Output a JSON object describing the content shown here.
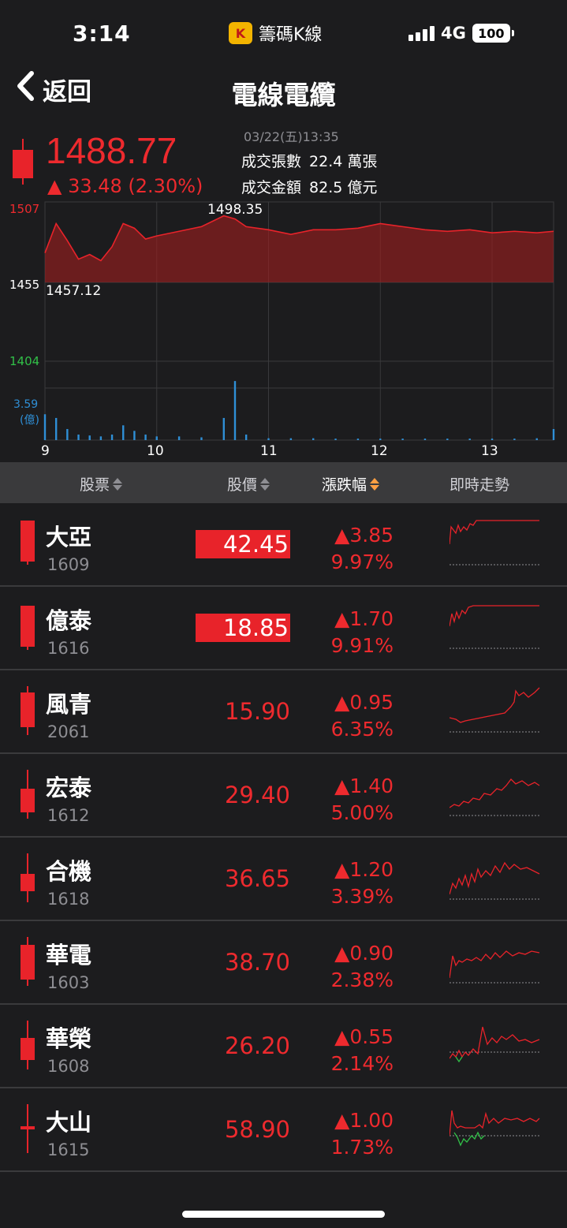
{
  "status_bar": {
    "time": "3:14",
    "app_name": "籌碼K線",
    "network": "4G",
    "battery": "100"
  },
  "nav": {
    "back_label": "返回",
    "title": "電線電纜"
  },
  "quote": {
    "price": "1488.77",
    "change": "▲ 33.48 (2.30%)",
    "datetime": "03/22(五)13:35",
    "volume_label": "成交張數",
    "volume_value": "22.4 萬張",
    "amount_label": "成交金額",
    "amount_value": "82.5 億元"
  },
  "chart": {
    "y_high": "1507",
    "y_mid": "1455",
    "y_low": "1404",
    "high_label": "1498.35",
    "low_label": "1457.12",
    "vol_max": "3.59",
    "vol_unit": "(億)",
    "x_ticks": [
      "9",
      "10",
      "11",
      "12",
      "13"
    ],
    "colors": {
      "up": "#e8232a",
      "down": "#31c048",
      "vol": "#2f8fd6"
    }
  },
  "chart_data": {
    "type": "line",
    "title": "",
    "ylim": [
      1404,
      1507
    ],
    "reference": 1455,
    "high": 1498.35,
    "low": 1457.12,
    "x": [
      9.0,
      9.1,
      9.2,
      9.3,
      9.4,
      9.5,
      9.6,
      9.7,
      9.8,
      9.9,
      10.0,
      10.2,
      10.4,
      10.6,
      10.7,
      10.8,
      11.0,
      11.2,
      11.4,
      11.6,
      11.8,
      12.0,
      12.2,
      12.4,
      12.6,
      12.8,
      13.0,
      13.2,
      13.4,
      13.55
    ],
    "values": [
      1474,
      1493,
      1482,
      1470,
      1473,
      1469,
      1478,
      1493,
      1490,
      1483,
      1485,
      1488,
      1491,
      1498,
      1496,
      1491,
      1489,
      1486,
      1489,
      1489,
      1490,
      1493,
      1491,
      1489,
      1488,
      1489,
      1487,
      1488,
      1487,
      1488
    ],
    "volume_ylim": [
      0,
      3.59
    ],
    "volume": [
      1.4,
      1.2,
      0.6,
      0.3,
      0.25,
      0.2,
      0.3,
      0.8,
      0.5,
      0.3,
      0.2,
      0.2,
      0.15,
      1.2,
      3.2,
      0.3,
      0.1,
      0.1,
      0.1,
      0.08,
      0.08,
      0.08,
      0.08,
      0.08,
      0.08,
      0.08,
      0.08,
      0.08,
      0.1,
      0.6
    ]
  },
  "table": {
    "headers": {
      "stock": "股票",
      "price": "股價",
      "change": "漲跌幅",
      "trend": "即時走勢"
    },
    "rows": [
      {
        "name": "大亞",
        "code": "1609",
        "price": "42.45",
        "change": "▲3.85",
        "pct": "9.97%"
      },
      {
        "name": "億泰",
        "code": "1616",
        "price": "18.85",
        "change": "▲1.70",
        "pct": "9.91%"
      },
      {
        "name": "風青",
        "code": "2061",
        "price": "15.90",
        "change": "▲0.95",
        "pct": "6.35%"
      },
      {
        "name": "宏泰",
        "code": "1612",
        "price": "29.40",
        "change": "▲1.40",
        "pct": "5.00%"
      },
      {
        "name": "合機",
        "code": "1618",
        "price": "36.65",
        "change": "▲1.20",
        "pct": "3.39%"
      },
      {
        "name": "華電",
        "code": "1603",
        "price": "38.70",
        "change": "▲0.90",
        "pct": "2.38%"
      },
      {
        "name": "華榮",
        "code": "1608",
        "price": "26.20",
        "change": "▲0.55",
        "pct": "2.14%"
      },
      {
        "name": "大山",
        "code": "1615",
        "price": "58.90",
        "change": "▲1.00",
        "pct": "1.73%"
      }
    ]
  }
}
